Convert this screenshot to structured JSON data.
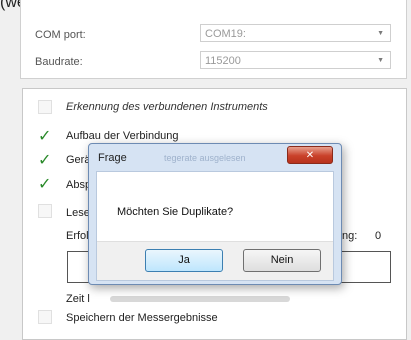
{
  "top_text": "(weitere",
  "settings": {
    "com_port": {
      "label": "COM port:",
      "value": "COM19:"
    },
    "baudrate": {
      "label": "Baudrate:",
      "value": "115200"
    }
  },
  "steps": {
    "recognition": "Erkennung des verbundenen Instruments",
    "connection": "Aufbau der Verbindung",
    "device_partial": "Gerä",
    "device_hidden": "tegerate ausgelesen",
    "query_partial": "Absp",
    "read_partial": "Lesen",
    "success_partial": "Erfolg",
    "counter_label": "ng:",
    "counter_value": "0",
    "time_partial": "Zeit l",
    "save": "Speichern der Messergebnisse"
  },
  "dialog": {
    "title": "Frage",
    "close_glyph": "✕",
    "message": "Möchten Sie Duplikate?",
    "yes": "Ja",
    "no": "Nein"
  }
}
